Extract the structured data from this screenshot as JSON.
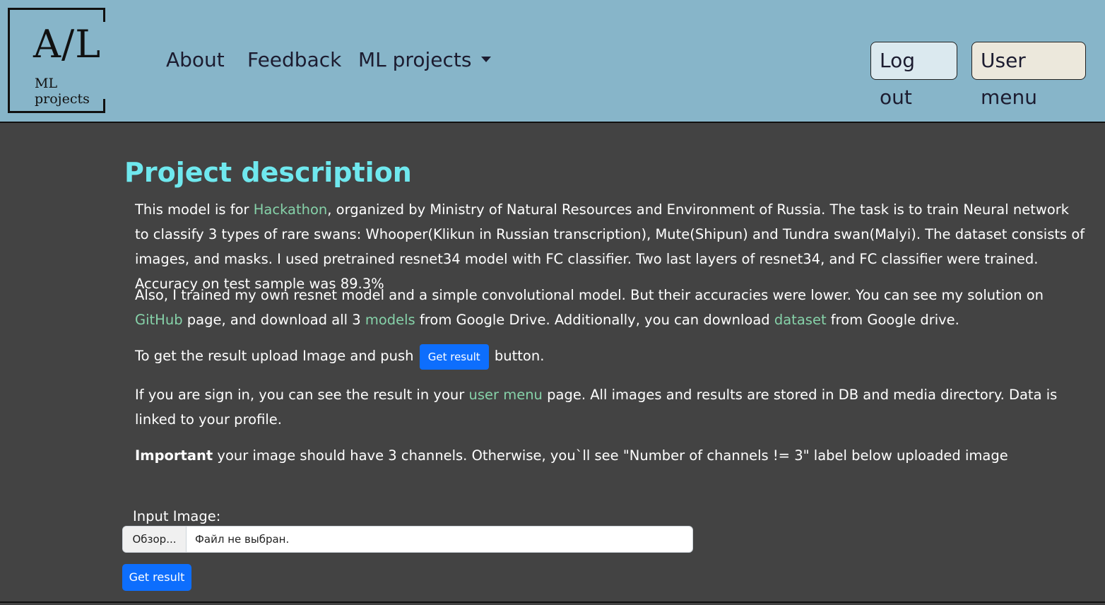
{
  "logo": {
    "big_text": "A/L",
    "small_text": "ML projects"
  },
  "nav": {
    "about": "About",
    "feedback": "Feedback",
    "ml_projects": "ML projects",
    "logout": "Log out",
    "user_menu": "User menu"
  },
  "colors": {
    "navbar_bg": "#87b5c9",
    "page_bg": "#434343",
    "title": "#6fe8ee",
    "link": "#86d2a9",
    "primary_button": "#0d6efd",
    "logout_button_bg": "#dbe9ef",
    "user_menu_button_bg": "#ece8dc"
  },
  "main": {
    "title": "Project description",
    "p1": {
      "t1": "This model is for ",
      "link_hackathon": "Hackathon",
      "t2": ", organized by Ministry of Natural Resources and Environment of Russia. The task is to train Neural network to classify 3 types of rare swans: Whooper(Klikun in Russian transcription), Mute(Shipun) and Tundra swan(Malyi). The dataset consists of images, and masks. I used pretrained resnet34 model with FC classifier. Two last layers of resnet34, and FC classifier were trained. Accuracy on test sample was 89.3%"
    },
    "p2": {
      "t1": "Also, I trained my own resnet model and a simple convolutional model. But their accuracies were lower. You can see my solution on ",
      "link_github": "GitHub",
      "t2": " page, and download all 3 ",
      "link_models": "models",
      "t3": " from Google Drive. Additionally, you can download ",
      "link_dataset": "dataset",
      "t4": " from Google drive."
    },
    "p3": {
      "t1": "To get the result upload Image and push ",
      "button": "Get result",
      "t2": " button."
    },
    "p4": {
      "t1": "If you are sign in, you can see the result in your ",
      "link_user_menu": "user menu",
      "t2": " page. All images and results are stored in DB and media directory. Data is linked to your profile."
    },
    "p5": {
      "bold": "Important",
      "t1": " your image should have 3 channels. Otherwise, you`ll see \"Number of channels != 3\" label below uploaded image"
    }
  },
  "form": {
    "label": "Input Image:",
    "browse": "Обзор...",
    "file_name": "Файл не выбран.",
    "submit": "Get result"
  }
}
